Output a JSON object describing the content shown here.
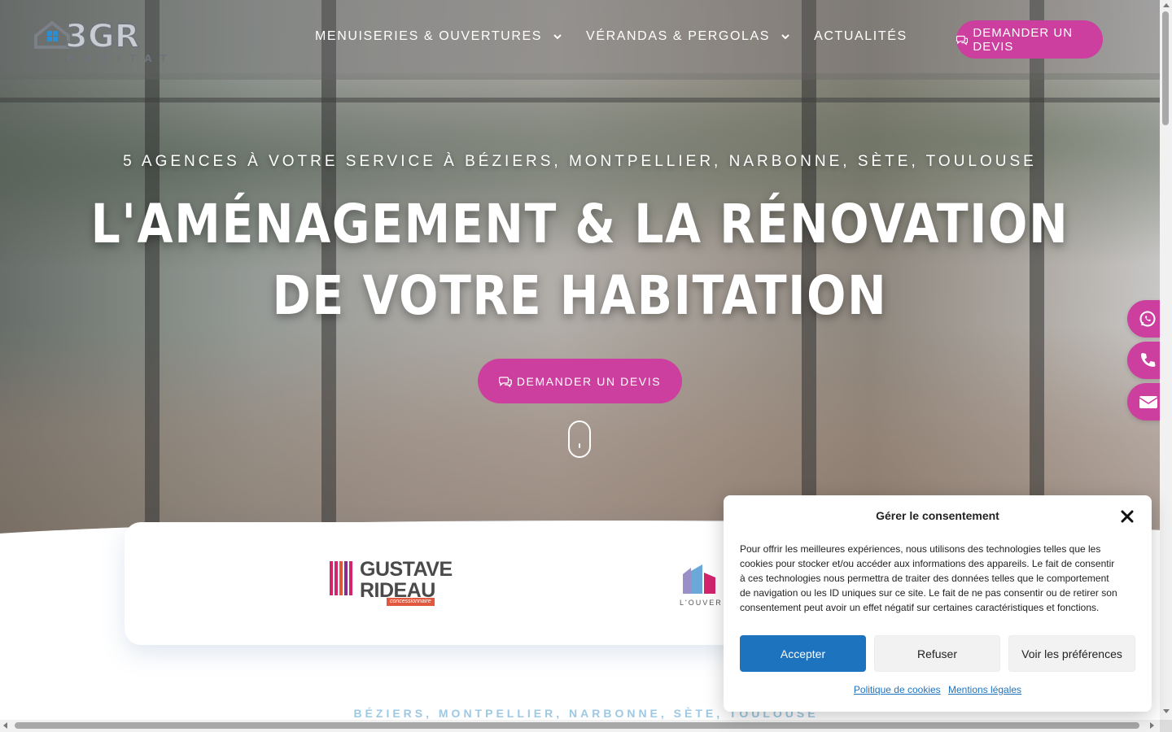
{
  "header": {
    "logo_text": "3GR",
    "logo_subtext": "HABITAT",
    "nav": [
      {
        "label": "MENUISERIES & OUVERTURES",
        "has_dropdown": true
      },
      {
        "label": "VÉRANDAS & PERGOLAS",
        "has_dropdown": true
      },
      {
        "label": "ACTUALITÉS",
        "has_dropdown": false
      }
    ],
    "cta_label": "DEMANDER UN DEVIS"
  },
  "hero": {
    "subtitle": "5 AGENCES À VOTRE SERVICE À BÉZIERS, MONTPELLIER, NARBONNE, SÈTE, TOULOUSE",
    "title_line1": "L'AMÉNAGEMENT & LA RÉNOVATION",
    "title_line2": "DE VOTRE HABITATION",
    "cta_label": "DEMANDER UN DEVIS"
  },
  "floating_contacts": [
    {
      "icon": "whatsapp-icon"
    },
    {
      "icon": "phone-icon"
    },
    {
      "icon": "envelope-icon"
    }
  ],
  "brands": [
    {
      "name_line1": "GUSTAVE",
      "name_line2": "RIDEAU",
      "tag": "concessionnaire"
    },
    {
      "caption": "L'OUVER"
    }
  ],
  "cities_label": "BÉZIERS, MONTPELLIER, NARBONNE, SÈTE, TOULOUSE",
  "consent": {
    "title": "Gérer le consentement",
    "body": "Pour offrir les meilleures expériences, nous utilisons des technologies telles que les cookies pour stocker et/ou accéder aux informations des appareils. Le fait de consentir à ces technologies nous permettra de traiter des données telles que le comportement de navigation ou les ID uniques sur ce site. Le fait de ne pas consentir ou de retirer son consentement peut avoir un effet négatif sur certaines caractéristiques et fonctions.",
    "accept_label": "Accepter",
    "refuse_label": "Refuser",
    "prefs_label": "Voir les préférences",
    "link_cookies": "Politique de cookies",
    "link_legal": "Mentions légales"
  },
  "colors": {
    "accent_pink": "#cc3f9f",
    "accept_blue": "#1e73be",
    "cities_blue": "#9ec9e3"
  }
}
